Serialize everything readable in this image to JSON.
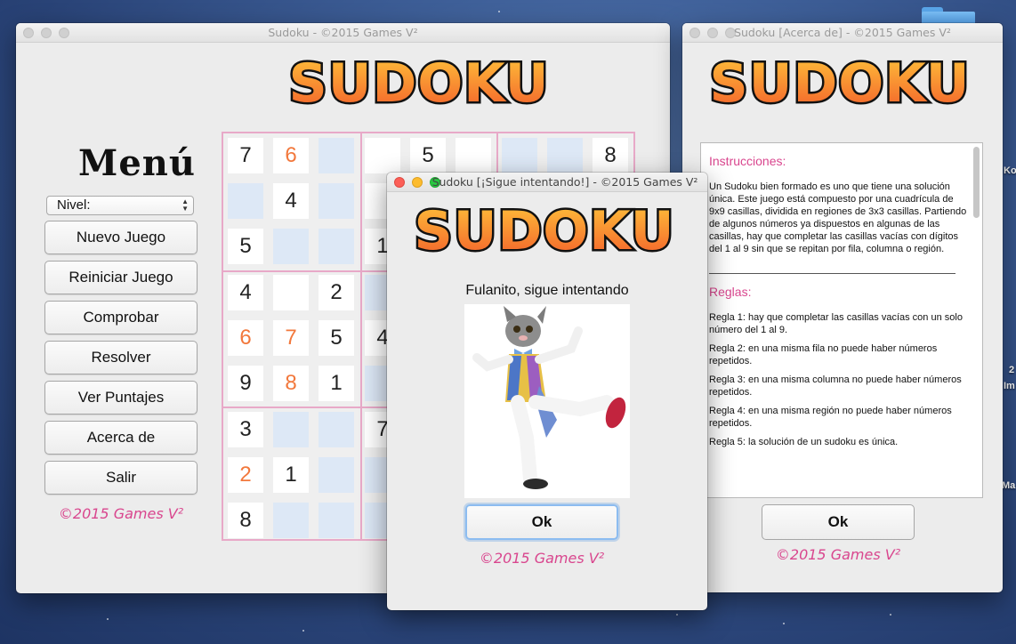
{
  "desktop": {
    "edge_texts": [
      "Ko",
      "2",
      "Im",
      "Ma"
    ]
  },
  "main_window": {
    "title": "Sudoku - ©2015 Games V²",
    "logo": "SUDOKU",
    "menu_title": "Menú",
    "level_select": {
      "label": "Nivel:"
    },
    "buttons": [
      "Nuevo Juego",
      "Reiniciar Juego",
      "Comprobar",
      "Resolver",
      "Ver Puntajes",
      "Acerca de",
      "Salir"
    ],
    "copyright": "©2015 Games V²",
    "grid": {
      "rows": [
        [
          {
            "v": "7",
            "s": "given"
          },
          {
            "v": "6",
            "s": "user"
          },
          {
            "v": "",
            "s": "empty"
          },
          {
            "v": "",
            "s": "given"
          },
          {
            "v": "5",
            "s": "given"
          },
          {
            "v": "",
            "s": "given"
          },
          {
            "v": "",
            "s": "empty"
          },
          {
            "v": "",
            "s": "empty"
          },
          {
            "v": "8",
            "s": "given"
          }
        ],
        [
          {
            "v": "",
            "s": "empty"
          },
          {
            "v": "4",
            "s": "given"
          },
          {
            "v": "",
            "s": "empty"
          },
          {
            "v": "",
            "s": "given"
          },
          {
            "v": "",
            "s": "given"
          },
          {
            "v": "",
            "s": "given"
          },
          {
            "v": "",
            "s": "empty"
          },
          {
            "v": "",
            "s": "empty"
          },
          {
            "v": "",
            "s": "empty"
          }
        ],
        [
          {
            "v": "5",
            "s": "given"
          },
          {
            "v": "",
            "s": "empty"
          },
          {
            "v": "",
            "s": "empty"
          },
          {
            "v": "1",
            "s": "given"
          },
          {
            "v": "",
            "s": "given"
          },
          {
            "v": "",
            "s": "given"
          },
          {
            "v": "",
            "s": "empty"
          },
          {
            "v": "",
            "s": "empty"
          },
          {
            "v": "",
            "s": "empty"
          }
        ],
        [
          {
            "v": "4",
            "s": "given"
          },
          {
            "v": "",
            "s": "given"
          },
          {
            "v": "2",
            "s": "given"
          },
          {
            "v": "",
            "s": "empty"
          },
          {
            "v": "",
            "s": "empty"
          },
          {
            "v": "",
            "s": "empty"
          },
          {
            "v": "",
            "s": "empty"
          },
          {
            "v": "",
            "s": "empty"
          },
          {
            "v": "",
            "s": "empty"
          }
        ],
        [
          {
            "v": "6",
            "s": "user"
          },
          {
            "v": "7",
            "s": "user"
          },
          {
            "v": "5",
            "s": "given"
          },
          {
            "v": "4",
            "s": "given"
          },
          {
            "v": "",
            "s": "empty"
          },
          {
            "v": "",
            "s": "empty"
          },
          {
            "v": "",
            "s": "empty"
          },
          {
            "v": "",
            "s": "empty"
          },
          {
            "v": "",
            "s": "empty"
          }
        ],
        [
          {
            "v": "9",
            "s": "given"
          },
          {
            "v": "8",
            "s": "user"
          },
          {
            "v": "1",
            "s": "given"
          },
          {
            "v": "",
            "s": "empty"
          },
          {
            "v": "",
            "s": "empty"
          },
          {
            "v": "",
            "s": "empty"
          },
          {
            "v": "",
            "s": "empty"
          },
          {
            "v": "",
            "s": "empty"
          },
          {
            "v": "",
            "s": "empty"
          }
        ],
        [
          {
            "v": "3",
            "s": "given"
          },
          {
            "v": "",
            "s": "empty"
          },
          {
            "v": "",
            "s": "empty"
          },
          {
            "v": "7",
            "s": "given"
          },
          {
            "v": "",
            "s": "empty"
          },
          {
            "v": "",
            "s": "empty"
          },
          {
            "v": "",
            "s": "empty"
          },
          {
            "v": "",
            "s": "empty"
          },
          {
            "v": "",
            "s": "empty"
          }
        ],
        [
          {
            "v": "2",
            "s": "user"
          },
          {
            "v": "1",
            "s": "given"
          },
          {
            "v": "",
            "s": "empty"
          },
          {
            "v": "",
            "s": "empty"
          },
          {
            "v": "",
            "s": "empty"
          },
          {
            "v": "",
            "s": "empty"
          },
          {
            "v": "",
            "s": "empty"
          },
          {
            "v": "",
            "s": "empty"
          },
          {
            "v": "",
            "s": "empty"
          }
        ],
        [
          {
            "v": "8",
            "s": "given"
          },
          {
            "v": "",
            "s": "empty"
          },
          {
            "v": "",
            "s": "empty"
          },
          {
            "v": "",
            "s": "empty"
          },
          {
            "v": "",
            "s": "empty"
          },
          {
            "v": "",
            "s": "empty"
          },
          {
            "v": "",
            "s": "empty"
          },
          {
            "v": "",
            "s": "empty"
          },
          {
            "v": "",
            "s": "empty"
          }
        ]
      ]
    }
  },
  "about_window": {
    "title": "Sudoku [Acerca de] - ©2015 Games V²",
    "logo": "SUDOKU",
    "instructions_heading": "Instrucciones:",
    "instructions_text": "Un Sudoku bien formado es uno que tiene una solución única. Este juego está compuesto por una cuadrícula de 9x9 casillas, dividida en regiones de 3x3 casillas. Partiendo de algunos números ya dispuestos en algunas de las casillas, hay que completar las casillas vacías con dígitos del 1 al 9 sin que se repitan por fila, columna o región.",
    "rules_heading": "Reglas:",
    "rules": [
      "Regla 1: hay que completar las casillas vacías con un solo número del 1 al 9.",
      "Regla 2: en una misma fila no puede haber números repetidos.",
      "Regla 3: en una misma columna no puede haber números repetidos.",
      "Regla 4: en una misma región no puede haber números repetidos.",
      "Regla 5: la solución de un sudoku es única."
    ],
    "ok_label": "Ok",
    "copyright": "©2015 Games V²"
  },
  "dialog": {
    "title": "Sudoku [¡Sigue intentando!] - ©2015 Games V²",
    "logo": "SUDOKU",
    "message": "Fulanito, sigue intentando",
    "ok_label": "Ok",
    "copyright": "©2015 Games V²"
  },
  "colors": {
    "accent_pink": "#d9468e",
    "user_digit_orange": "#f2783c",
    "logo_orange": "#f79a2a"
  }
}
